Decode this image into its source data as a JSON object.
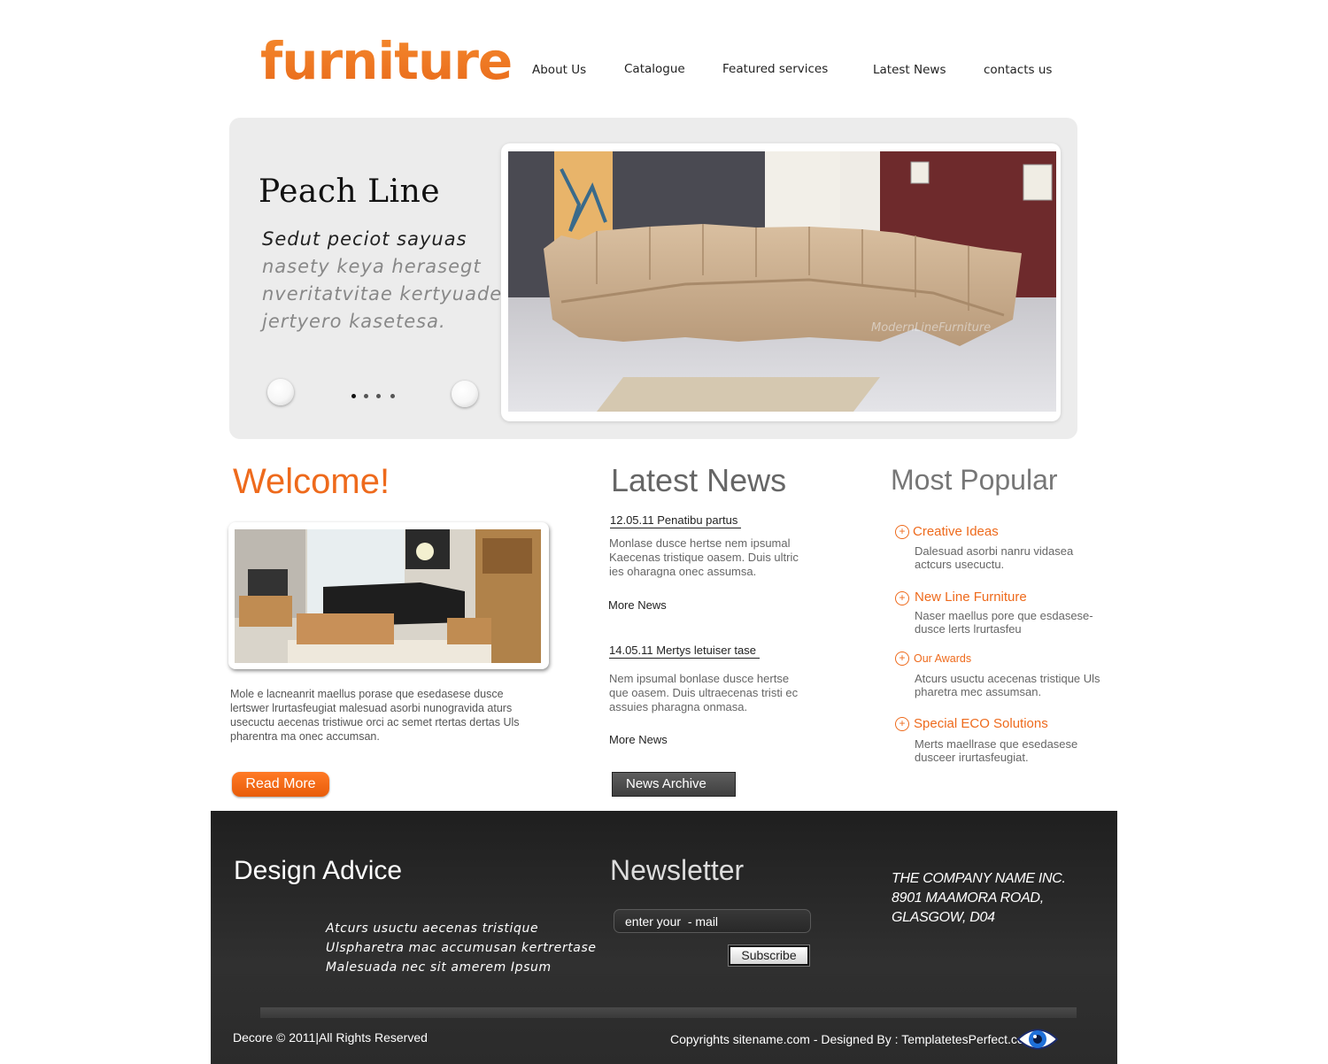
{
  "header": {
    "logo": "furniture",
    "nav": [
      "About Us",
      "Catalogue",
      "Featured services",
      "Latest News",
      "contacts us"
    ]
  },
  "slider": {
    "title": "Peach Line",
    "text_line1": "Sedut peciot sayuas",
    "text_line2": "nasety keya herasegt",
    "text_line3": "nveritatvitae kertyuade",
    "text_line4": "jertyero kasetesa.",
    "image_watermark": "ModernLineFurniture",
    "dots_count": 4
  },
  "welcome": {
    "title": "Welcome!",
    "text": "Mole e lacneanrit maellus porase que esedasese dusce lertswer lrurtasfeugiat malesuad asorbi nunogravida aturs usecuctu aecenas tristiwue orci ac semet rtertas dertas Uls pharentra ma onec accumsan.",
    "button": "Read More"
  },
  "latest_news": {
    "title": "Latest News",
    "items": [
      {
        "headline": "12.05.11 Penatibu partus",
        "body": "Monlase dusce hertse nem ipsumal Kaecenas tristique oasem. Duis ultric ies oharagna onec assumsa.",
        "more": "More News"
      },
      {
        "headline": "14.05.11 Mertys letuiser tase",
        "body": "Nem ipsumal bonlase dusce hertse que oasem. Duis ultraecenas tristi ec assuies pharagna onmasa.",
        "more": "More News"
      }
    ],
    "archive_button": "News Archive"
  },
  "most_popular": {
    "title": "Most Popular",
    "items": [
      {
        "title": "Creative Ideas",
        "text": "Dalesuad asorbi nanru vidasea actcurs usecuctu."
      },
      {
        "title": "New Line Furniture",
        "text": "Naser maellus pore que esdasese-dusce lerts lrurtasfeu"
      },
      {
        "title": "Our Awards",
        "text": "Atcurs usuctu acecenas tristique Uls pharetra mec assumsan."
      },
      {
        "title": "Special ECO Solutions",
        "text": "Merts maellrase que esedasese dusceer irurtasfeugiat."
      }
    ]
  },
  "footer": {
    "design_title": "Design Advice",
    "quote": [
      "Atcurs usuctu aecenas tristique",
      "Ulspharetra mac accumusan kertrertase",
      "Malesuada nec sit amerem Ipsum"
    ],
    "newsletter_title": "Newsletter",
    "newsletter_value": "enter your  - mail",
    "subscribe": "Subscribe",
    "address": [
      "THE COMPANY NAME INC.",
      "8901 MAAMORA ROAD,",
      "GLASGOW, D04"
    ],
    "copyright_left": "Decore © 2011|All Rights Reserved",
    "copyright_right": "Copyrights sitename.com - Designed By : TemplatetesPerfect.com"
  },
  "colors": {
    "accent": "#ee6a1c",
    "footer_bg": "#2b2b2b",
    "slider_bg": "#ececec"
  }
}
